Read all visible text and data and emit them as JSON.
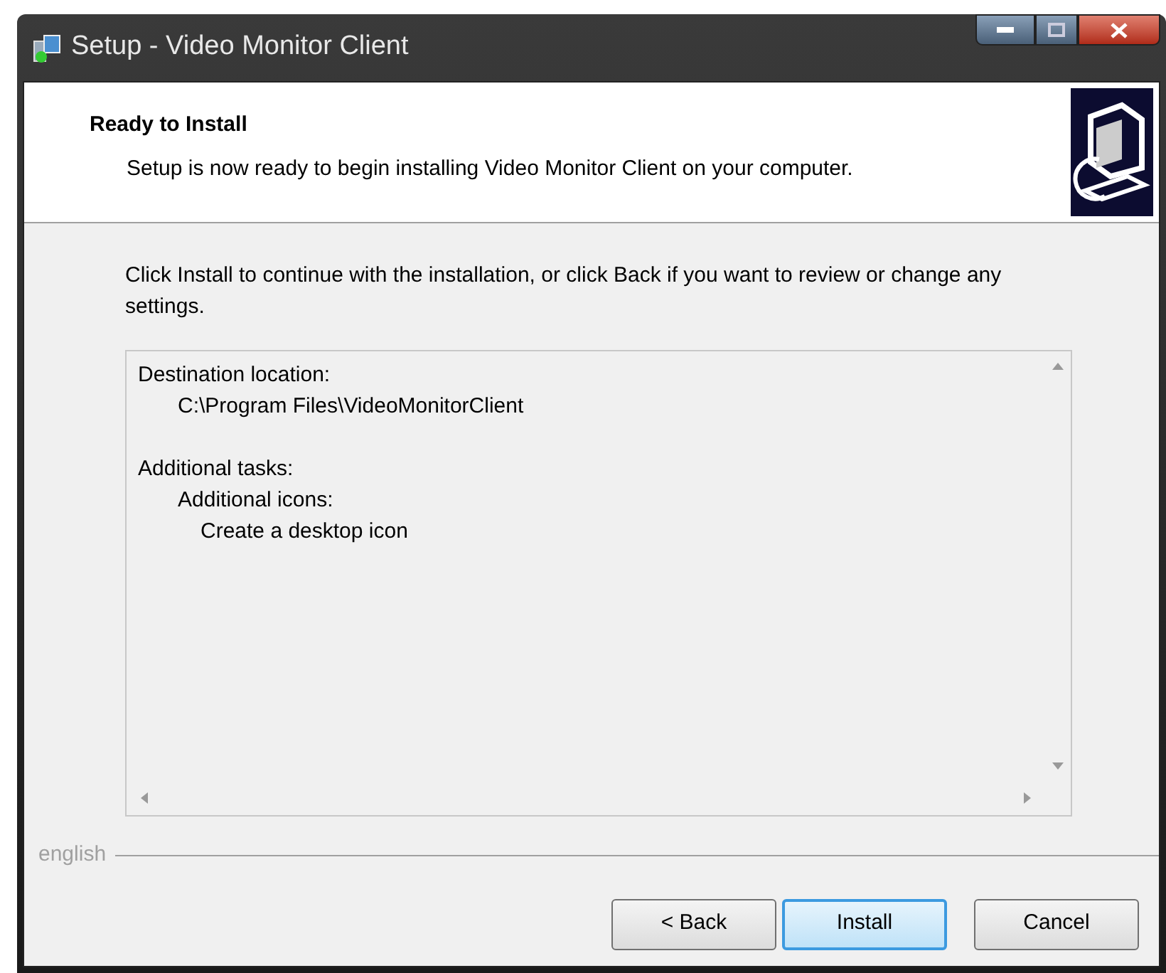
{
  "window": {
    "title": "Setup - Video Monitor Client"
  },
  "header": {
    "title": "Ready to Install",
    "subtitle": "Setup is now ready to begin installing Video Monitor Client on your computer."
  },
  "instructions": "Click Install to continue with the installation, or click Back if you want to review or change any settings.",
  "memo": [
    {
      "text": "Destination location:",
      "children": [
        {
          "text": "C:\\Program Files\\VideoMonitorClient"
        }
      ]
    },
    {
      "text": "Additional tasks:",
      "children": [
        {
          "text": "Additional icons:",
          "children": [
            {
              "text": "Create a desktop icon"
            }
          ]
        }
      ]
    }
  ],
  "language": "english",
  "buttons": [
    {
      "label": "< Back",
      "default": false
    },
    {
      "label": "Install",
      "default": true
    },
    {
      "label": "Cancel",
      "default": false
    }
  ]
}
